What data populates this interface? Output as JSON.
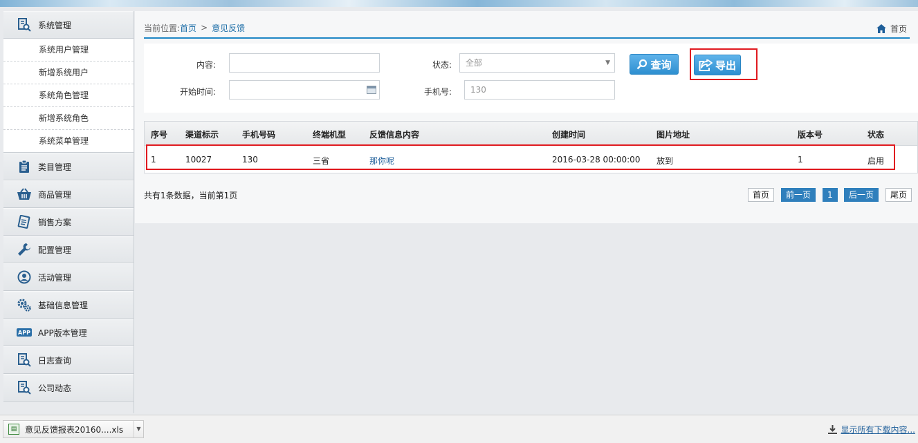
{
  "sidebar": {
    "groups": [
      {
        "label": "系统管理",
        "icon": "doc-search-icon"
      },
      {
        "label": "类目管理",
        "icon": "clipboard-icon"
      },
      {
        "label": "商品管理",
        "icon": "basket-icon"
      },
      {
        "label": "销售方案",
        "icon": "notepad-icon"
      },
      {
        "label": "配置管理",
        "icon": "wrench-icon"
      },
      {
        "label": "活动管理",
        "icon": "person-circle-icon"
      },
      {
        "label": "基础信息管理",
        "icon": "gears-icon"
      },
      {
        "label": "APP版本管理",
        "icon": "app-badge-icon"
      },
      {
        "label": "日志查询",
        "icon": "doc-search-icon"
      },
      {
        "label": "公司动态",
        "icon": "doc-search-icon"
      }
    ],
    "sub_items": [
      "系统用户管理",
      "新增系统用户",
      "系统角色管理",
      "新增系统角色",
      "系统菜单管理"
    ],
    "app_badge_text": "APP"
  },
  "breadcrumb": {
    "prefix": "当前位置:",
    "home": "首页",
    "sep": ">",
    "current": "意见反馈",
    "home_right": "首页"
  },
  "filters": {
    "content_label": "内容:",
    "content_value": "",
    "status_label": "状态:",
    "status_value": "全部",
    "start_label": "开始时间:",
    "start_value": "",
    "phone_label": "手机号:",
    "phone_value": "130",
    "search_button": "查询",
    "export_button": "导出"
  },
  "table": {
    "headers": [
      "序号",
      "渠道标示",
      "手机号码",
      "终端机型",
      "反馈信息内容",
      "创建时间",
      "图片地址",
      "版本号",
      "状态"
    ],
    "rows": [
      [
        "1",
        "10027",
        "130",
        "三省",
        "那你呢",
        "2016-03-28 00:00:00",
        "放到",
        "1",
        "启用"
      ]
    ]
  },
  "summary": "共有1条数据，当前第1页",
  "pagination": {
    "first": "首页",
    "prev": "前一页",
    "current": "1",
    "next": "后一页",
    "last": "尾页"
  },
  "download_bar": {
    "file_name": "意见反馈报表20160....xls",
    "show_all": "显示所有下载内容..."
  },
  "colors": {
    "accent": "#1f87c5",
    "button": "#2e8fd0",
    "highlight_red": "#e0191f",
    "link": "#1f5f9a"
  }
}
